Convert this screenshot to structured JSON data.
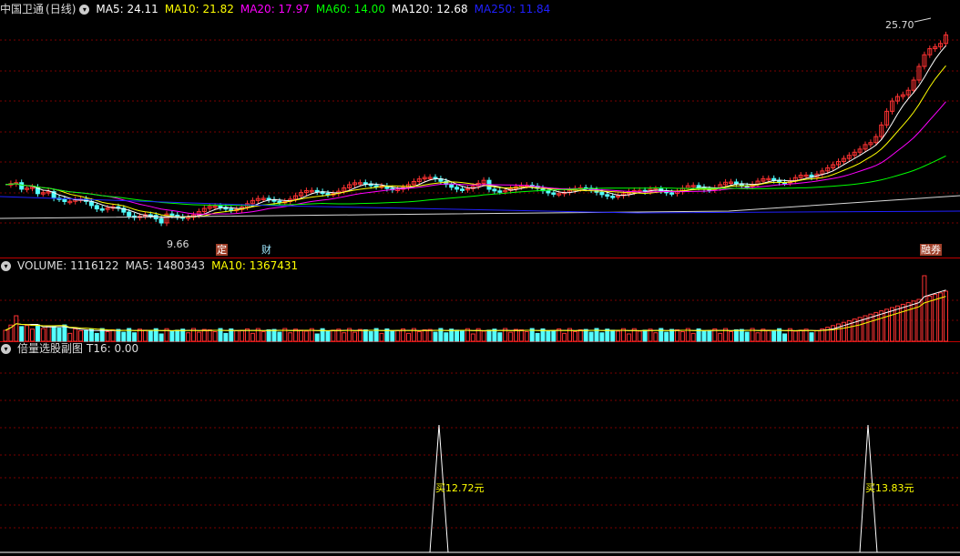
{
  "main": {
    "stock_name": "中国卫通",
    "period": "(日线)",
    "ma": [
      {
        "label": "MA5: 24.11",
        "color": "#ffffff"
      },
      {
        "label": "MA10: 21.82",
        "color": "#ffff00"
      },
      {
        "label": "MA20: 17.97",
        "color": "#ff00ff"
      },
      {
        "label": "MA60: 14.00",
        "color": "#00ff00"
      },
      {
        "label": "MA120: 12.68",
        "color": "#ffffff"
      },
      {
        "label": "MA250: 11.84",
        "color": "#2020ff"
      }
    ],
    "high_label": "25.70",
    "low_label": "9.66",
    "badges": {
      "ding": "定",
      "cai": "财",
      "rongquan": "融券"
    }
  },
  "volume": {
    "title": "VOLUME: 1116122",
    "ma5": "MA5: 1480343",
    "ma10": "MA10: 1367431"
  },
  "sub": {
    "title": "倍量选股副图",
    "t16": "T16: 0.00",
    "signals": [
      {
        "text": "买12.72元"
      },
      {
        "text": "买13.83元"
      }
    ]
  },
  "colors": {
    "up": "#ff3232",
    "down": "#54ffff",
    "grid": "#7a0000",
    "separator": "#c00000"
  }
}
